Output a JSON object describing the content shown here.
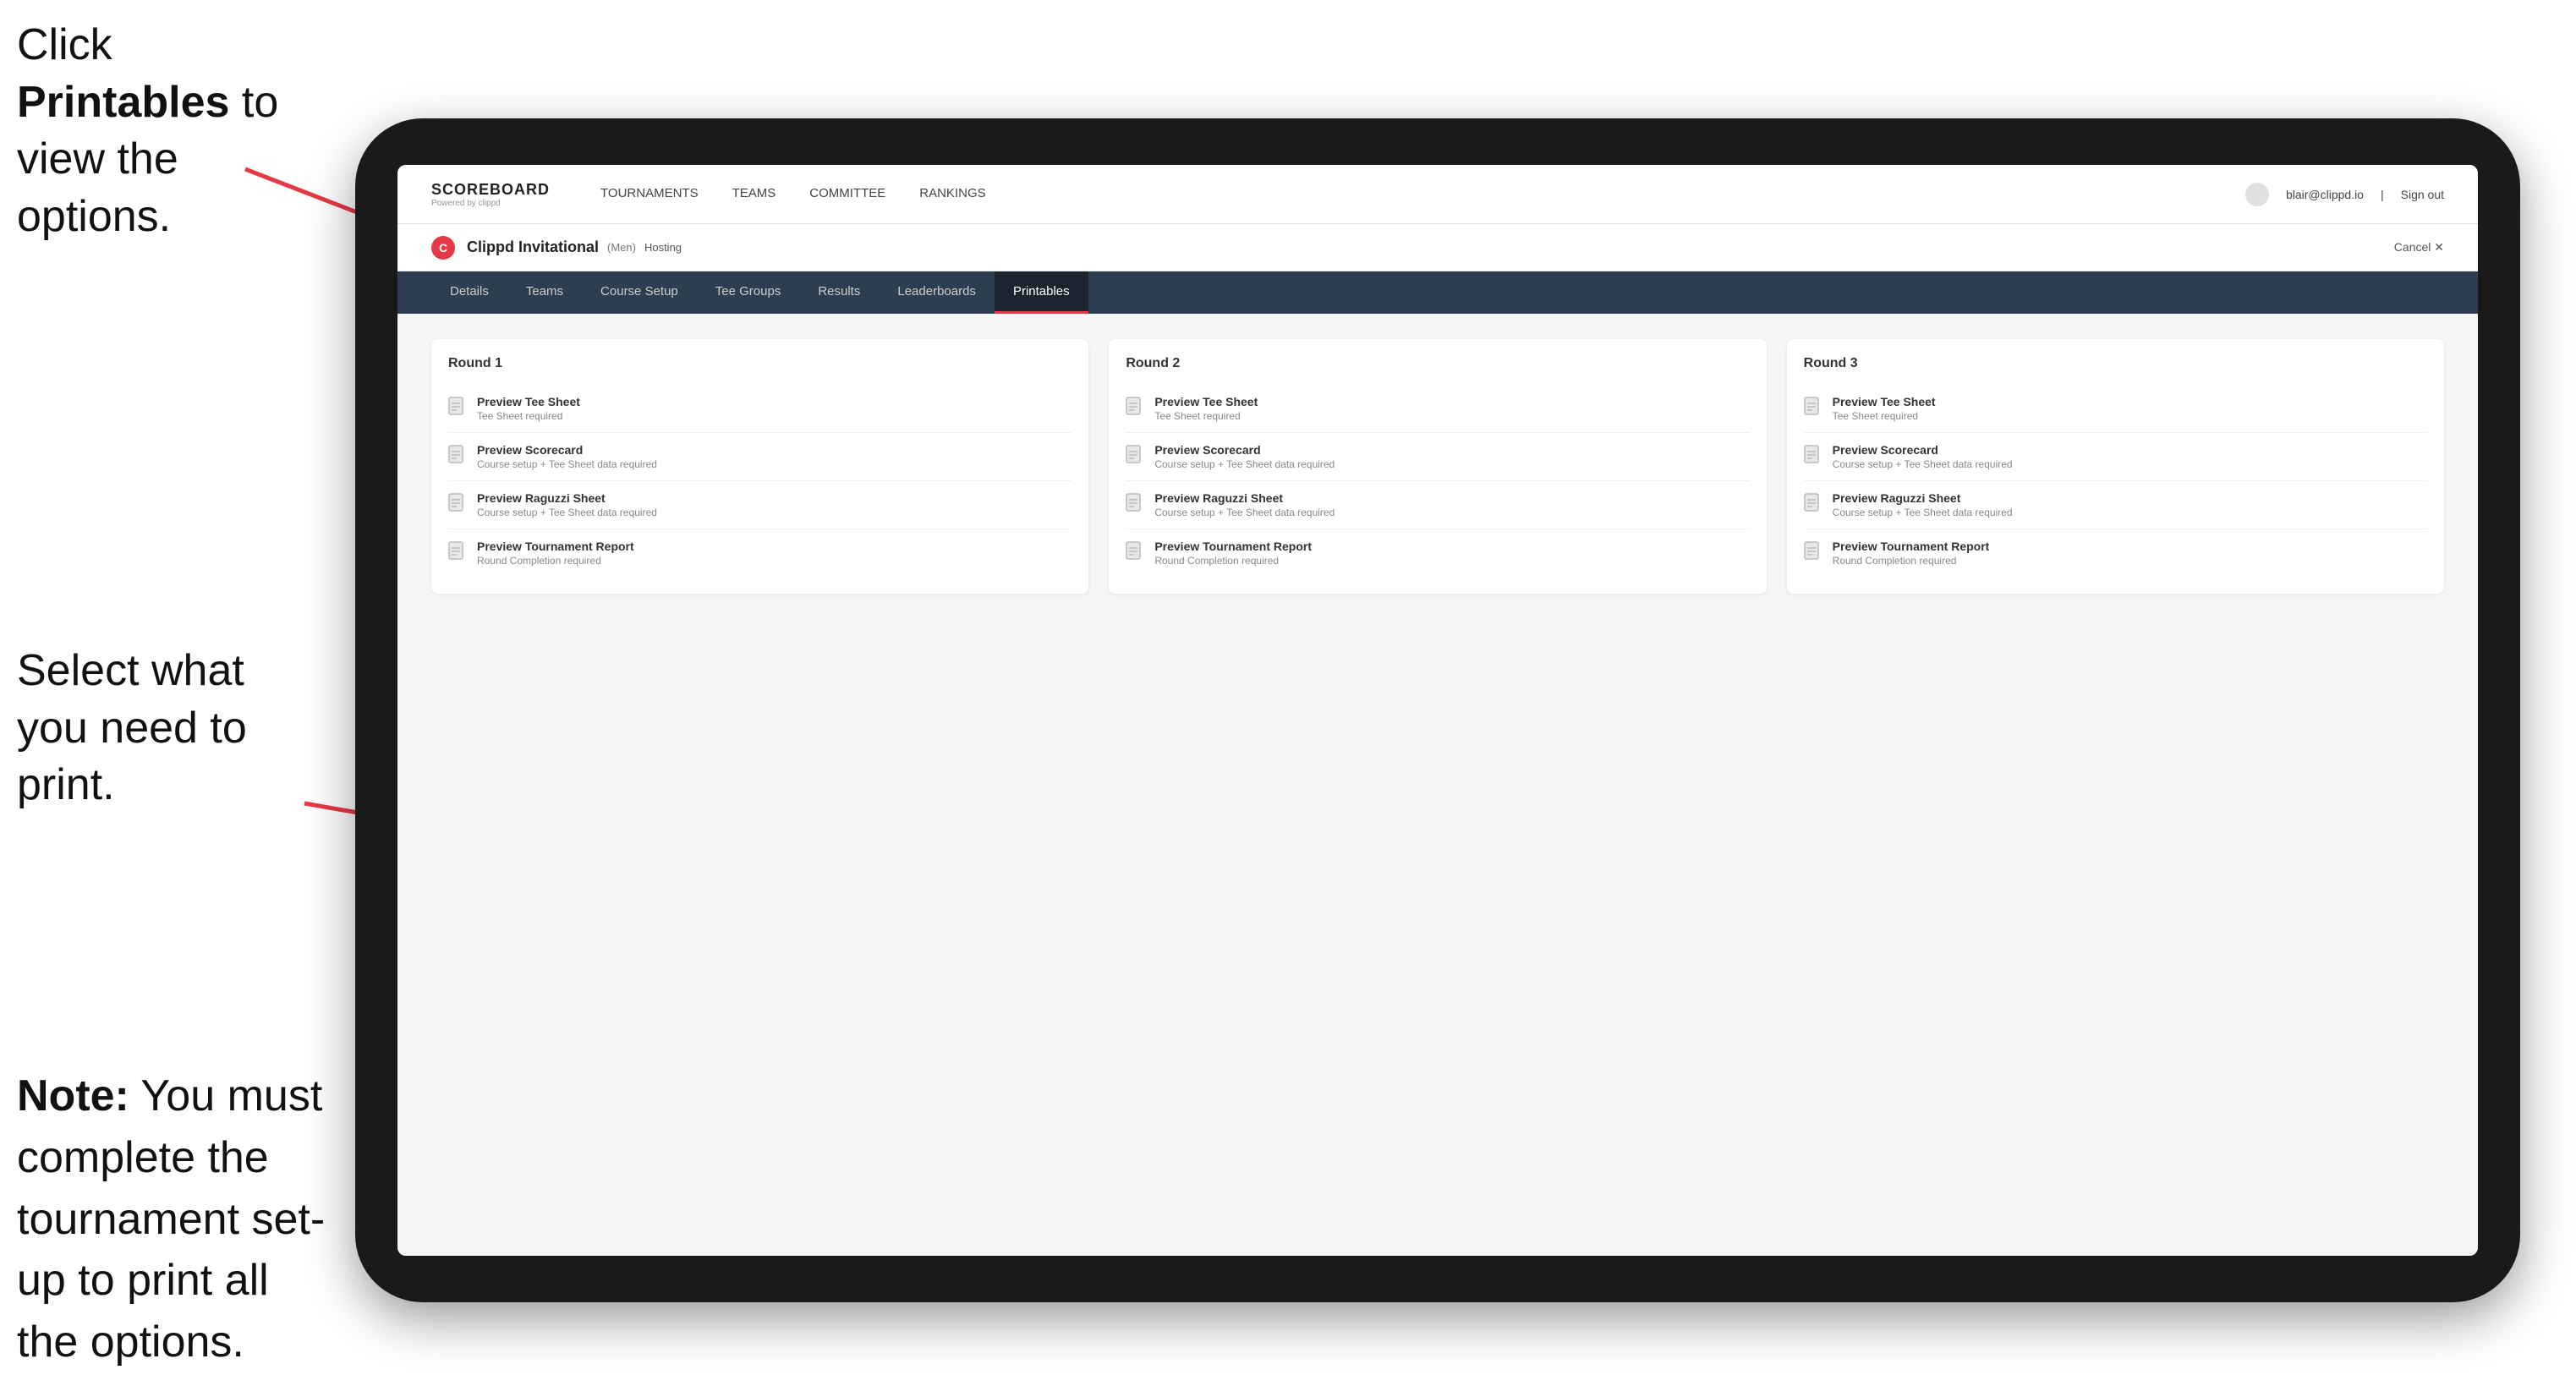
{
  "annotations": {
    "top": {
      "part1": "Click ",
      "bold": "Printables",
      "part2": " to view the options."
    },
    "middle": "Select what you need to print.",
    "bottom": {
      "bold": "Note:",
      "text": " You must complete the tournament set-up to print all the options."
    }
  },
  "topnav": {
    "logo": "SCOREBOARD",
    "powered_by": "Powered by clippd",
    "links": [
      {
        "label": "TOURNAMENTS",
        "active": false
      },
      {
        "label": "TEAMS",
        "active": false
      },
      {
        "label": "COMMITTEE",
        "active": false
      },
      {
        "label": "RANKINGS",
        "active": false
      }
    ],
    "user_email": "blair@clippd.io",
    "sign_out": "Sign out"
  },
  "tournament": {
    "logo_letter": "C",
    "name": "Clippd Invitational",
    "badge": "(Men)",
    "hosting": "Hosting",
    "cancel": "Cancel ✕"
  },
  "subnav": {
    "tabs": [
      {
        "label": "Details",
        "active": false
      },
      {
        "label": "Teams",
        "active": false
      },
      {
        "label": "Course Setup",
        "active": false
      },
      {
        "label": "Tee Groups",
        "active": false
      },
      {
        "label": "Results",
        "active": false
      },
      {
        "label": "Leaderboards",
        "active": false
      },
      {
        "label": "Printables",
        "active": true
      }
    ]
  },
  "rounds": [
    {
      "title": "Round 1",
      "items": [
        {
          "title": "Preview Tee Sheet",
          "subtitle": "Tee Sheet required"
        },
        {
          "title": "Preview Scorecard",
          "subtitle": "Course setup + Tee Sheet data required"
        },
        {
          "title": "Preview Raguzzi Sheet",
          "subtitle": "Course setup + Tee Sheet data required"
        },
        {
          "title": "Preview Tournament Report",
          "subtitle": "Round Completion required"
        }
      ]
    },
    {
      "title": "Round 2",
      "items": [
        {
          "title": "Preview Tee Sheet",
          "subtitle": "Tee Sheet required"
        },
        {
          "title": "Preview Scorecard",
          "subtitle": "Course setup + Tee Sheet data required"
        },
        {
          "title": "Preview Raguzzi Sheet",
          "subtitle": "Course setup + Tee Sheet data required"
        },
        {
          "title": "Preview Tournament Report",
          "subtitle": "Round Completion required"
        }
      ]
    },
    {
      "title": "Round 3",
      "items": [
        {
          "title": "Preview Tee Sheet",
          "subtitle": "Tee Sheet required"
        },
        {
          "title": "Preview Scorecard",
          "subtitle": "Course setup + Tee Sheet data required"
        },
        {
          "title": "Preview Raguzzi Sheet",
          "subtitle": "Course setup + Tee Sheet data required"
        },
        {
          "title": "Preview Tournament Report",
          "subtitle": "Round Completion required"
        }
      ]
    }
  ]
}
